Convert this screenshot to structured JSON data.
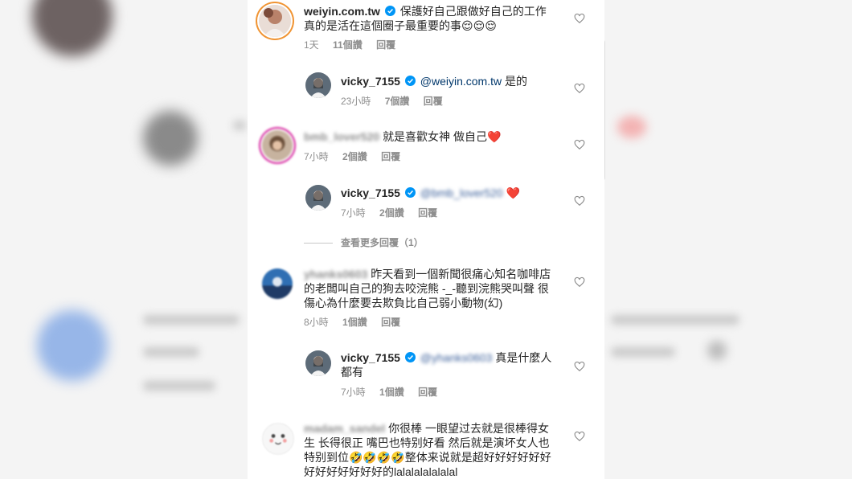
{
  "colors": {
    "accent_blue": "#0095f6",
    "heart_red": "#ed4956",
    "meta_gray": "#8e8e8e",
    "mention": "#00376b"
  },
  "comments": [
    {
      "username": "weiyin.com.tw",
      "verified": true,
      "text_line1": "保護好自己跟做好自己的工作",
      "text_line2": "真的是活在這個圈子最重要的事😌😌😌",
      "time": "1天",
      "likes": "11個讚",
      "reply": "回覆"
    },
    {
      "username": "vicky_7155",
      "verified": true,
      "mention": "@weiyin.com.tw",
      "text": "是的",
      "time": "23小時",
      "likes": "7個讚",
      "reply": "回覆"
    },
    {
      "username": "bmb_lover520",
      "text": "就是喜歡女神 做自己❤️",
      "time": "7小時",
      "likes": "2個讚",
      "reply": "回覆"
    },
    {
      "username": "vicky_7155",
      "verified": true,
      "mention": "@bmb_lover520",
      "text": "❤️",
      "time": "7小時",
      "likes": "2個讚",
      "reply": "回覆"
    },
    {
      "username": "yhanks0603",
      "text_line1": "昨天看到一個新聞很痛心知名咖啡店",
      "text_line2": "的老闆叫自己的狗去咬浣熊 -_-聽到浣熊哭叫聲 很",
      "text_line3": "傷心為什麼要去欺負比自己弱小動物(幻)",
      "time": "8小時",
      "likes": "1個讚",
      "reply": "回覆"
    },
    {
      "username": "vicky_7155",
      "verified": true,
      "mention": "@yhanks0603",
      "text_line1": "真是什麼人",
      "text_line2": "都有",
      "time": "7小時",
      "likes": "1個讚",
      "reply": "回覆"
    },
    {
      "username": "madam_sandel",
      "text_line1": "你很棒 一眼望过去就是很棒得女",
      "text_line2": "生 长得很正 嘴巴也特别好看 然后就是演坏女人也",
      "text_line3": "特别到位🤣🤣🤣🤣整体来说就是超好好好好好好",
      "text_line4": "好好好好好好好的lalalalalalalal"
    }
  ],
  "view_more": "查看更多回覆（1）",
  "icons": {
    "verified": "verified-badge-icon",
    "like": "heart-outline-icon"
  }
}
